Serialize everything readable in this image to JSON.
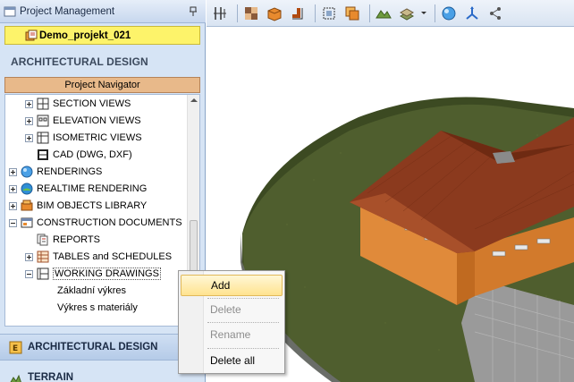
{
  "panel": {
    "title": "Project Management",
    "project_name": "Demo_projekt_021",
    "section_title": "ARCHITECTURAL DESIGN",
    "navigator_label": "Project Navigator"
  },
  "tree": {
    "items": [
      {
        "label": "SECTION VIEWS",
        "expander": "plus",
        "icon": "section-views-icon"
      },
      {
        "label": "ELEVATION VIEWS",
        "expander": "plus",
        "icon": "elevation-views-icon"
      },
      {
        "label": "ISOMETRIC VIEWS",
        "expander": "plus",
        "icon": "isometric-views-icon"
      },
      {
        "label": "CAD (DWG, DXF)",
        "expander": "none",
        "icon": "cad-icon"
      },
      {
        "label": "RENDERINGS",
        "expander": "plus",
        "icon": "renderings-icon"
      },
      {
        "label": "REALTIME RENDERING",
        "expander": "plus",
        "icon": "realtime-rendering-icon"
      },
      {
        "label": "BIM OBJECTS LIBRARY",
        "expander": "plus",
        "icon": "bim-library-icon"
      },
      {
        "label": "CONSTRUCTION DOCUMENTS",
        "expander": "minus",
        "icon": "construction-documents-icon"
      },
      {
        "label": "REPORTS",
        "expander": "none",
        "icon": "reports-icon"
      },
      {
        "label": "TABLES and SCHEDULES",
        "expander": "plus",
        "icon": "tables-icon"
      },
      {
        "label": "WORKING DRAWINGS",
        "expander": "minus",
        "icon": "working-drawings-icon"
      },
      {
        "label": "Základní výkres",
        "expander": "none",
        "icon": ""
      },
      {
        "label": "Výkres s materiály",
        "expander": "none",
        "icon": ""
      }
    ]
  },
  "bottom_tabs": {
    "active": "ARCHITECTURAL DESIGN",
    "next": "TERRAIN"
  },
  "context_menu": {
    "add": "Add",
    "delete": "Delete",
    "rename": "Rename",
    "delete_all": "Delete all"
  },
  "colors": {
    "project_highlight": "#fdf36a",
    "navigator_bar": "#e8b98a",
    "roof": "#8b3a1e",
    "wall": "#e08a3a",
    "terrain": "#4a5a2c"
  }
}
